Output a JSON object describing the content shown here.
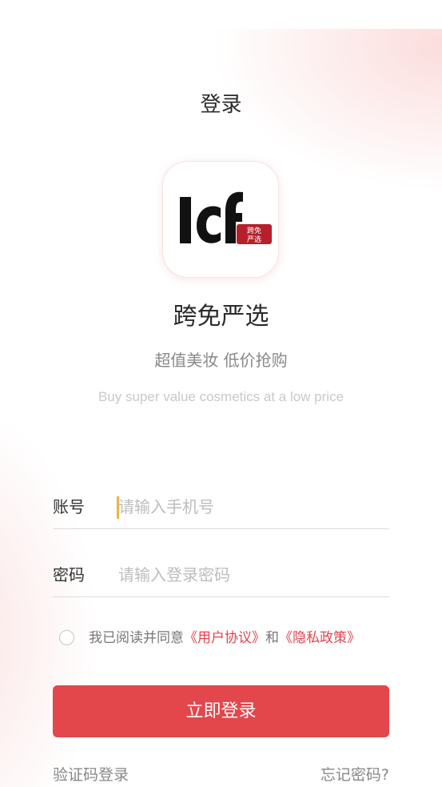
{
  "header": {
    "title": "登录"
  },
  "logo": {
    "mark_text": "lcf",
    "badge_text_line1": "跨免",
    "badge_text_line2": "严选",
    "badge_color": "#b61f2b",
    "mark_color": "#111111"
  },
  "brand": {
    "app_name": "跨免严选",
    "slogan_cn": "超值美妆 低价抢购",
    "slogan_en": "Buy super value cosmetics at a low price"
  },
  "form": {
    "account": {
      "label": "账号",
      "placeholder": "请输入手机号",
      "value": ""
    },
    "password": {
      "label": "密码",
      "placeholder": "请输入登录密码",
      "value": ""
    }
  },
  "agreement": {
    "prefix": "我已阅读并同意",
    "user_agreement": "《用户协议》",
    "conjunction": "和",
    "privacy_policy": "《隐私政策》",
    "checked": false
  },
  "actions": {
    "login_label": "立即登录",
    "sms_login_label": "验证码登录",
    "forgot_label": "忘记密码?"
  },
  "colors": {
    "accent": "#e3464b",
    "link": "#e0454b",
    "caret": "#f0b43c"
  }
}
